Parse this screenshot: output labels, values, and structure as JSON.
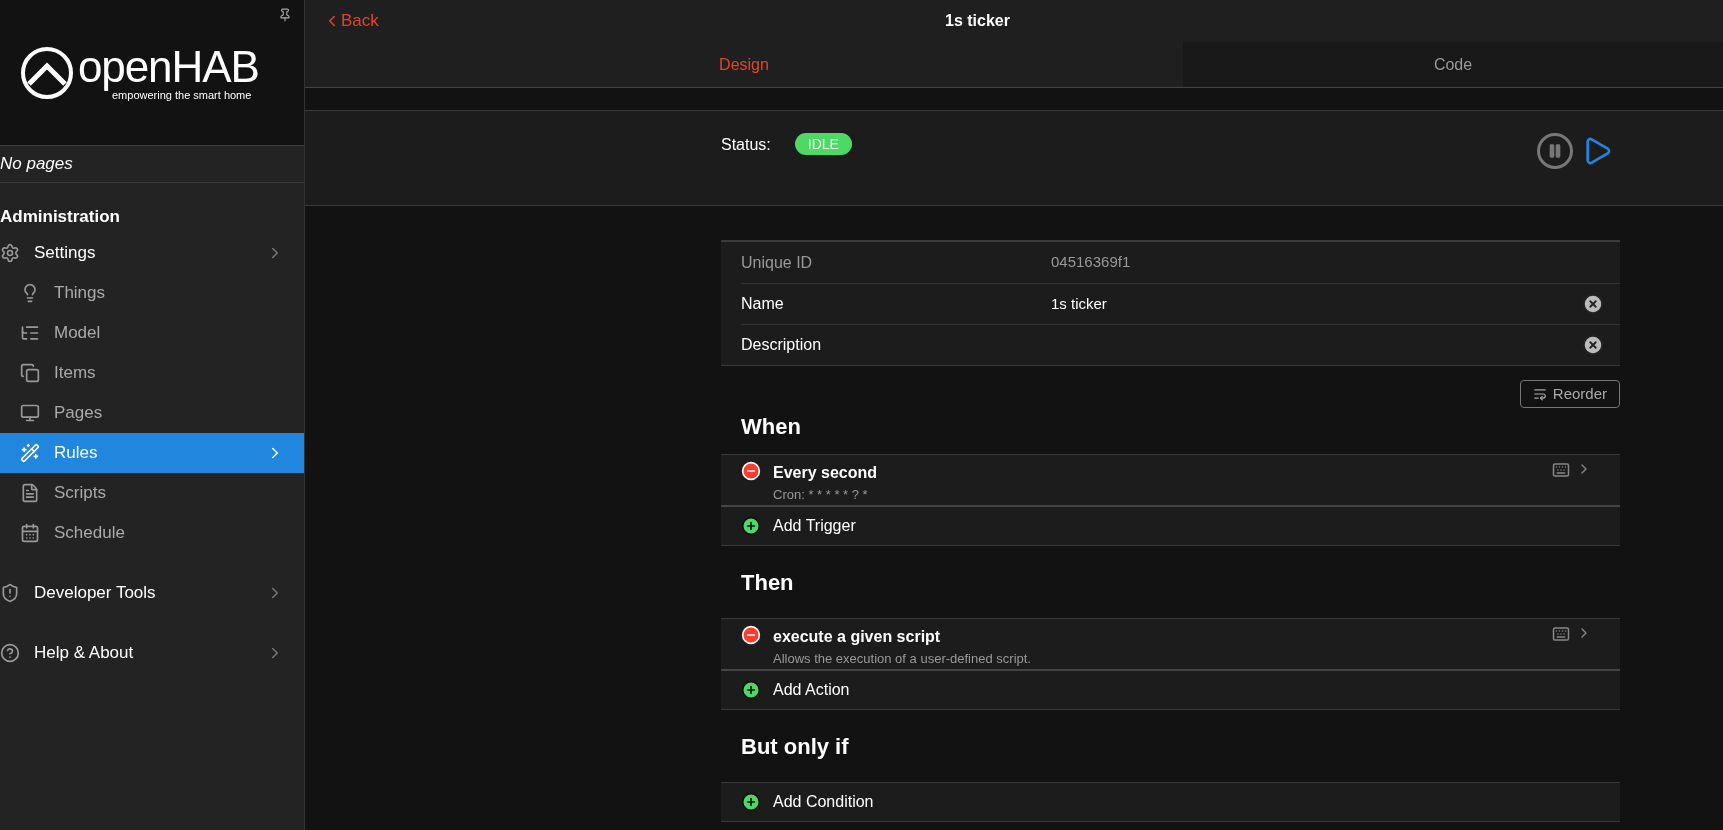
{
  "sidebar": {
    "logo": {
      "name": "openHAB",
      "tagline": "empowering the smart home"
    },
    "pages_note": "No pages",
    "section_title": "Administration",
    "items": [
      {
        "label": "Settings",
        "kind": "top",
        "selected": false
      },
      {
        "label": "Things",
        "kind": "sub",
        "selected": false
      },
      {
        "label": "Model",
        "kind": "sub",
        "selected": false
      },
      {
        "label": "Items",
        "kind": "sub",
        "selected": false
      },
      {
        "label": "Pages",
        "kind": "sub",
        "selected": false
      },
      {
        "label": "Rules",
        "kind": "sub",
        "selected": true
      },
      {
        "label": "Scripts",
        "kind": "sub",
        "selected": false
      },
      {
        "label": "Schedule",
        "kind": "sub",
        "selected": false
      },
      {
        "label": "Developer Tools",
        "kind": "top",
        "selected": false
      },
      {
        "label": "Help & About",
        "kind": "top",
        "selected": false
      }
    ]
  },
  "navbar": {
    "back": "Back",
    "title": "1s ticker"
  },
  "tabs": [
    {
      "label": "Design",
      "selected": true
    },
    {
      "label": "Code",
      "selected": false
    }
  ],
  "status": {
    "label": "Status:",
    "badge": "IDLE"
  },
  "fields": [
    {
      "label": "Unique ID",
      "value": "04516369f1",
      "disabled": true
    },
    {
      "label": "Name",
      "value": "1s ticker",
      "disabled": false
    },
    {
      "label": "Description",
      "disabled": false
    }
  ],
  "reorder": "Reorder",
  "sections": [
    {
      "title": "When",
      "items": [
        {
          "title": "Every second",
          "subtitle": "Cron: * * * * * ? *"
        }
      ],
      "add": "Add Trigger"
    },
    {
      "title": "Then",
      "items": [
        {
          "title": "execute a given script",
          "subtitle": "Allows the execution of a user-defined script."
        }
      ],
      "add": "Add Action"
    },
    {
      "title": "But only if",
      "add": "Add Condition"
    }
  ]
}
